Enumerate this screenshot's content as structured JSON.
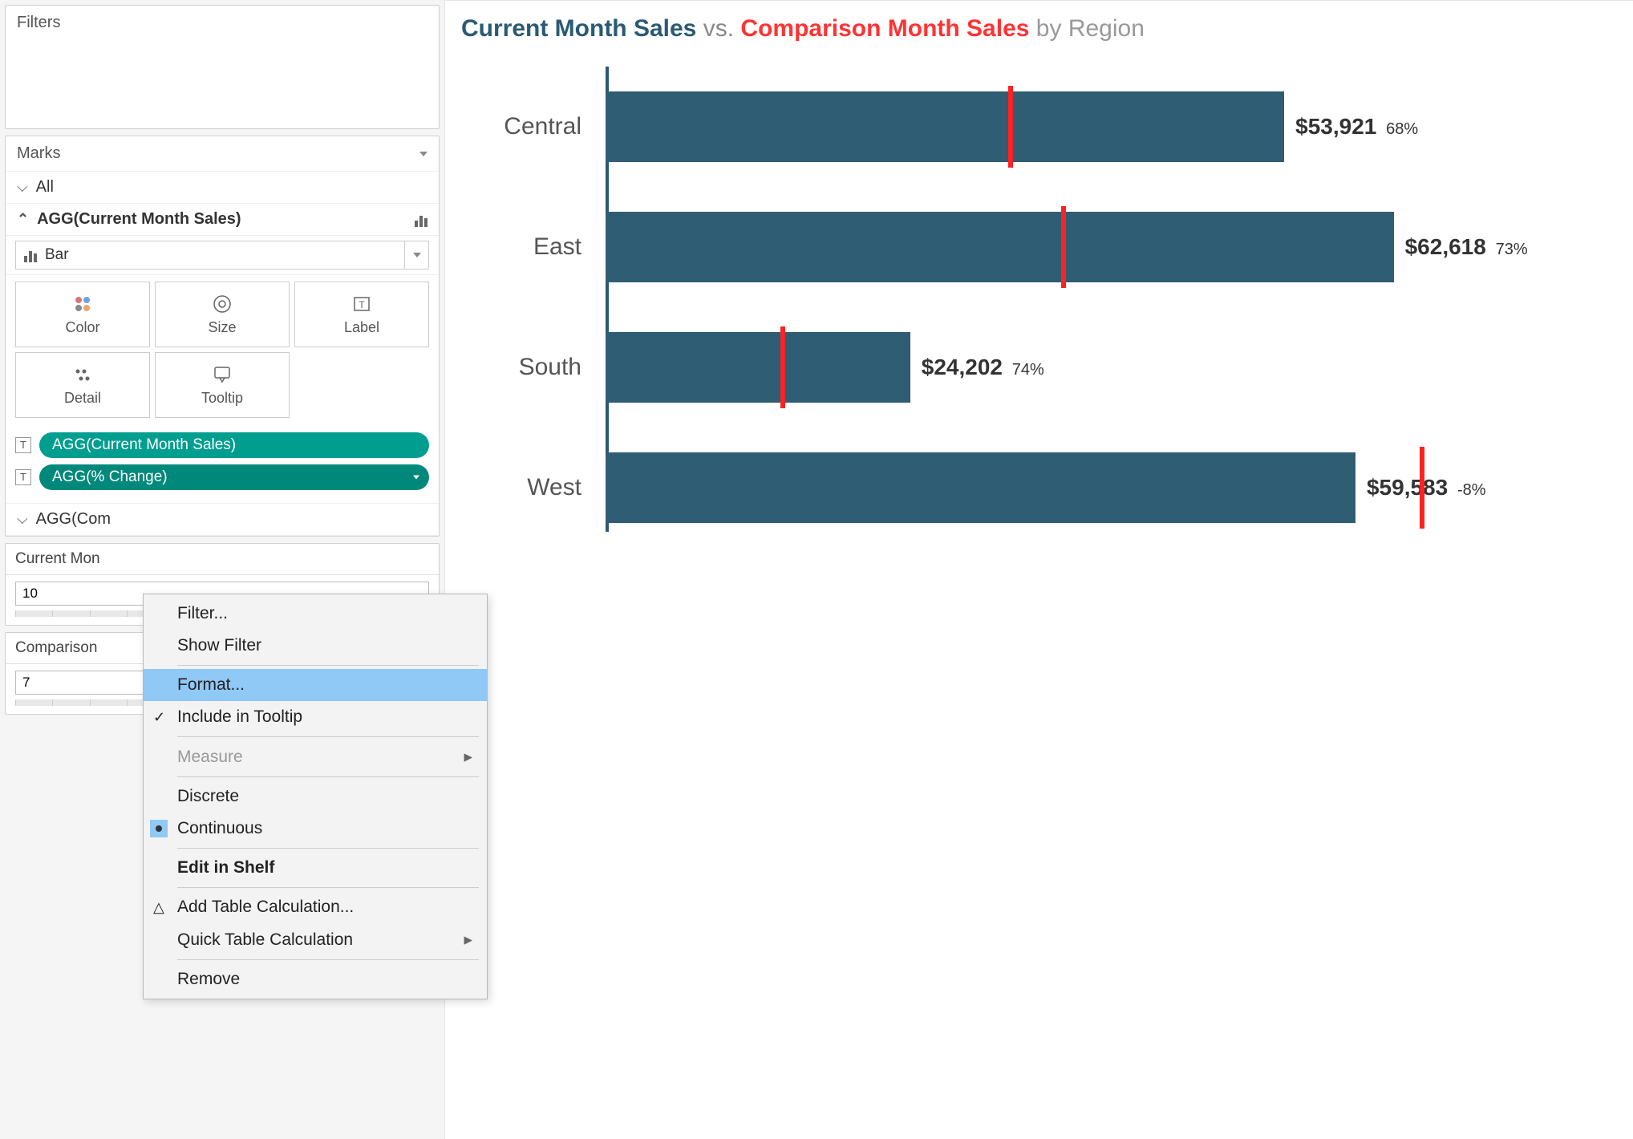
{
  "left_panel": {
    "filters_title": "Filters",
    "marks_title": "Marks",
    "marks_all": "All",
    "marks_agg_current": "AGG(Current Month Sales)",
    "marks_agg_comparison": "AGG(Com",
    "marks_type_label": "Bar",
    "mark_buttons": {
      "color": "Color",
      "size": "Size",
      "label": "Label",
      "detail": "Detail",
      "tooltip": "Tooltip"
    },
    "pills": [
      {
        "label": "AGG(Current Month Sales)"
      },
      {
        "label": "AGG(% Change)",
        "active": true
      }
    ],
    "params": [
      {
        "title": "Current Mon",
        "value": "10"
      },
      {
        "title": "Comparison",
        "value": "7"
      }
    ]
  },
  "chart_data": {
    "type": "bar",
    "orientation": "horizontal",
    "title_parts": {
      "t1": "Current Month Sales",
      "t2": "vs.",
      "t3": "Comparison Month Sales",
      "t4": "by Region"
    },
    "xmax": 65000,
    "rows": [
      {
        "label": "Central",
        "value": 53921,
        "value_label": "$53,921",
        "pct_label": "68%",
        "comparison": 32000
      },
      {
        "label": "East",
        "value": 62618,
        "value_label": "$62,618",
        "pct_label": "73%",
        "comparison": 36200
      },
      {
        "label": "South",
        "value": 24202,
        "value_label": "$24,202",
        "pct_label": "74%",
        "comparison": 13900
      },
      {
        "label": "West",
        "value": 59583,
        "value_label": "$59,583",
        "pct_label": "-8%",
        "comparison": 64700
      }
    ]
  },
  "context_menu": {
    "filter": "Filter...",
    "show_filter": "Show Filter",
    "format": "Format...",
    "include_tooltip": "Include in Tooltip",
    "measure": "Measure",
    "discrete": "Discrete",
    "continuous": "Continuous",
    "edit_shelf": "Edit in Shelf",
    "add_table_calc": "Add Table Calculation...",
    "quick_table_calc": "Quick Table Calculation",
    "remove": "Remove"
  }
}
